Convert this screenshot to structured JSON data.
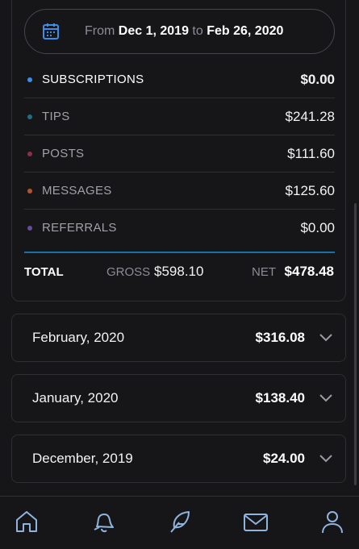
{
  "date_range": {
    "from_label": "From",
    "from_date": "Dec 1, 2019",
    "to_label": "to",
    "to_date": "Feb 26, 2020"
  },
  "categories": [
    {
      "label": "SUBSCRIPTIONS",
      "value": "$0.00",
      "dot_color": "#3b8ee8"
    },
    {
      "label": "TIPS",
      "value": "$241.28",
      "dot_color": "#1f6d82"
    },
    {
      "label": "POSTS",
      "value": "$111.60",
      "dot_color": "#8a2f45"
    },
    {
      "label": "MESSAGES",
      "value": "$125.60",
      "dot_color": "#b5532e"
    },
    {
      "label": "REFERRALS",
      "value": "$0.00",
      "dot_color": "#6a4a9c"
    }
  ],
  "totals": {
    "label": "TOTAL",
    "gross_label": "GROSS",
    "gross_value": "$598.10",
    "net_label": "NET",
    "net_value": "$478.48"
  },
  "months": [
    {
      "label": "February, 2020",
      "amount": "$316.08"
    },
    {
      "label": "January, 2020",
      "amount": "$138.40"
    },
    {
      "label": "December, 2019",
      "amount": "$24.00"
    }
  ],
  "nav": [
    "home-icon",
    "bell-icon",
    "feather-icon",
    "mail-icon",
    "profile-icon"
  ],
  "colors": {
    "accent": "#3b8ee8",
    "background": "#161618",
    "total_line": "#1e6ea8"
  }
}
